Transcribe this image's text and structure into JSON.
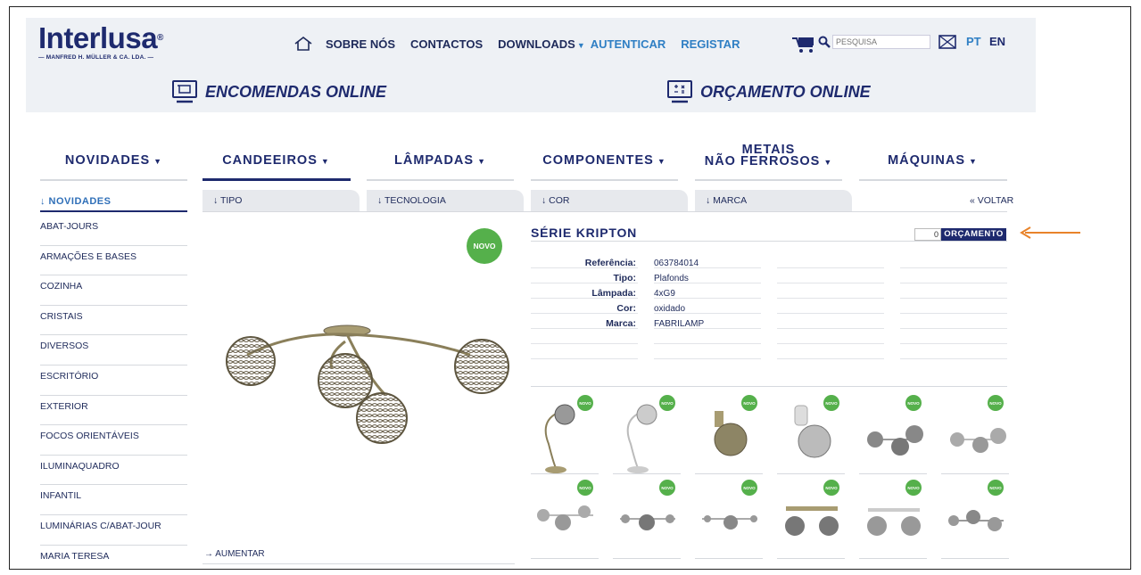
{
  "header": {
    "logo_main": "Interlusa",
    "logo_reg": "®",
    "logo_sub": "— MANFRED H. MÜLLER & CA. LDA. —",
    "nav": {
      "about": "SOBRE NÓS",
      "contacts": "CONTACTOS",
      "downloads": "DOWNLOADS",
      "login": "AUTENTICAR",
      "register": "REGISTAR"
    },
    "search_placeholder": "PESQUISA",
    "lang_pt": "PT",
    "lang_en": "EN"
  },
  "subbar": {
    "orders": "ENCOMENDAS ONLINE",
    "quote": "ORÇAMENTO ONLINE"
  },
  "main_menu": {
    "novidades": "NOVIDADES",
    "candeeiros": "CANDEEIROS",
    "lampadas": "LÂMPADAS",
    "componentes": "COMPONENTES",
    "metais_1": "METAIS",
    "metais_2": "NÃO FERROSOS",
    "maquinas": "MÁQUINAS"
  },
  "sidebar": {
    "heading": "↓  NOVIDADES",
    "items": [
      "ABAT-JOURS",
      "ARMAÇÕES E BASES",
      "COZINHA",
      "CRISTAIS",
      "DIVERSOS",
      "ESCRITÓRIO",
      "EXTERIOR",
      "FOCOS ORIENTÁVEIS",
      "ILUMINAQUADRO",
      "INFANTIL",
      "LUMINÁRIAS C/ABAT-JOUR",
      "MARIA TERESA"
    ]
  },
  "filters": {
    "tipo": "↓  TIPO",
    "tecnologia": "↓  TECNOLOGIA",
    "cor": "↓  COR",
    "marca": "↓  MARCA",
    "voltar": "«  VOLTAR"
  },
  "product": {
    "badge": "NOVO",
    "title": "SÉRIE KRIPTON",
    "qty": "0",
    "quote_button": "ORÇAMENTO",
    "zoom": "→  AUMENTAR",
    "specs": [
      {
        "label": "Referência:",
        "value": "063784014"
      },
      {
        "label": "Tipo:",
        "value": "Plafonds"
      },
      {
        "label": "Lâmpada:",
        "value": "4xG9"
      },
      {
        "label": "Cor:",
        "value": "oxidado"
      },
      {
        "label": "Marca:",
        "value": "FABRILAMP"
      }
    ]
  },
  "thumbs_badge": "NOVO",
  "colors": {
    "navy": "#1e2a6e",
    "blue": "#2f7fc4",
    "green": "#55b04b",
    "orange": "#e8832a",
    "bar_bg": "#eef1f5"
  }
}
